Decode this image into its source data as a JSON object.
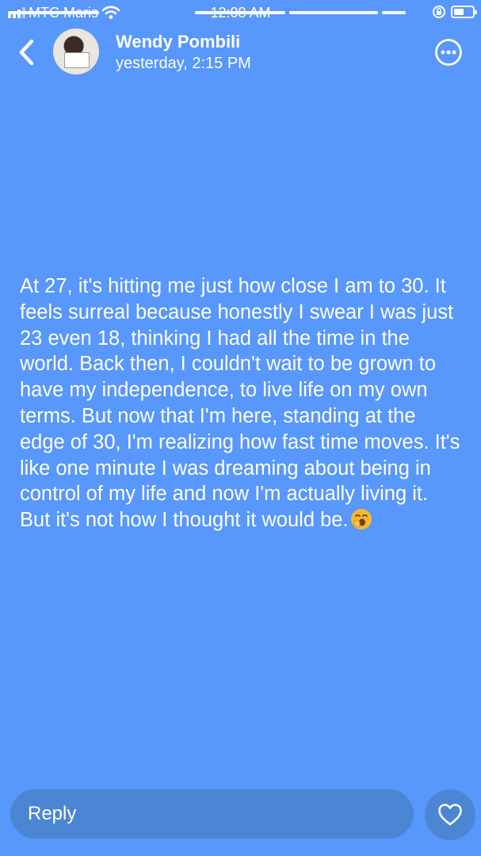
{
  "status_bar": {
    "carrier": "MTC Maris",
    "time": "12:08 AM",
    "battery_level": 0.55
  },
  "story_progress": [
    1,
    1,
    1,
    1
  ],
  "header": {
    "name": "Wendy Pombili",
    "timestamp": "yesterday, 2:15 PM",
    "icons": [
      "back-chevron-icon",
      "avatar",
      "more-options-icon"
    ]
  },
  "story": {
    "text": "At 27, it's hitting me just how close I am to 30. It feels surreal because honestly I swear I was just\n23 even 18, thinking I had all the time in the world. Back then, I couldn't wait to be grown to have my independence, to live life on my own terms. But now that I'm here, standing at the edge of 30, I'm realizing how fast time moves. It's like one minute I was dreaming about being in control of my life and now I'm actually living it.\nBut it's not how I thought it would be.",
    "emoji": "yawning-face-emoji"
  },
  "footer": {
    "reply_label": "Reply",
    "like_icon": "heart-icon"
  },
  "colors": {
    "background": "#5897fb",
    "reply_bg": "#4b86d4",
    "emoji": "#f5b82e"
  }
}
